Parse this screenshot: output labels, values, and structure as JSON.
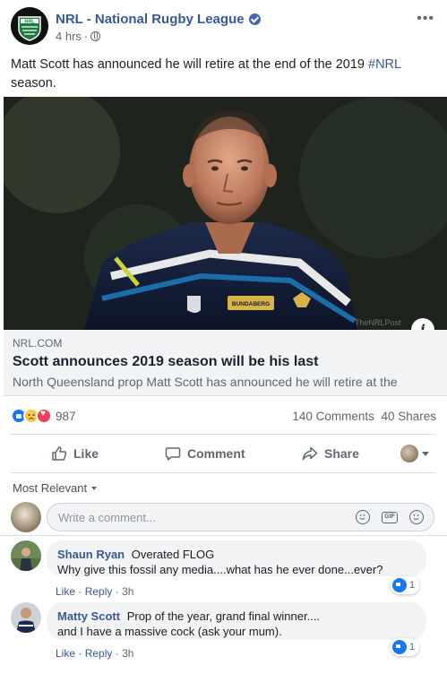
{
  "post": {
    "page_name": "NRL - National Rugby League",
    "time": "4 hrs",
    "text": "Matt Scott has announced he will retire at the end of the 2019",
    "hashtag": "#NRL",
    "text_end": "season.",
    "logo_text": "NRL",
    "image_watermark": "TheNRLPost",
    "jersey_sponsor": "BUNDABERG"
  },
  "link": {
    "domain": "NRL.COM",
    "title": "Scott announces 2019 season will be his last",
    "description": "North Queensland prop Matt Scott has announced he will retire at the"
  },
  "stats": {
    "reaction_count": "987",
    "comments": "140 Comments",
    "shares": "40 Shares"
  },
  "actions": {
    "like": "Like",
    "comment": "Comment",
    "share": "Share"
  },
  "sort_label": "Most Relevant",
  "compose": {
    "placeholder": "Write a comment..."
  },
  "comments": [
    {
      "name": "Shaun Ryan",
      "text_line1": "Overated FLOG",
      "text_line2": "Why give this fossil any media....what has he ever done...ever?",
      "like": "Like",
      "reply": "Reply",
      "time": "3h",
      "reaction_count": "1"
    },
    {
      "name": "Matty Scott",
      "text_line1": "Prop of the year, grand final winner....",
      "text_line2": "and I have a massive cock (ask your mum).",
      "like": "Like",
      "reply": "Reply",
      "time": "3h",
      "reaction_count": "1"
    }
  ],
  "colors": {
    "link_blue": "#385898",
    "like_blue": "#1877f2",
    "love_red": "#f33e58",
    "sad_yellow": "#f7c843",
    "nrl_green": "#1b7a3a"
  }
}
